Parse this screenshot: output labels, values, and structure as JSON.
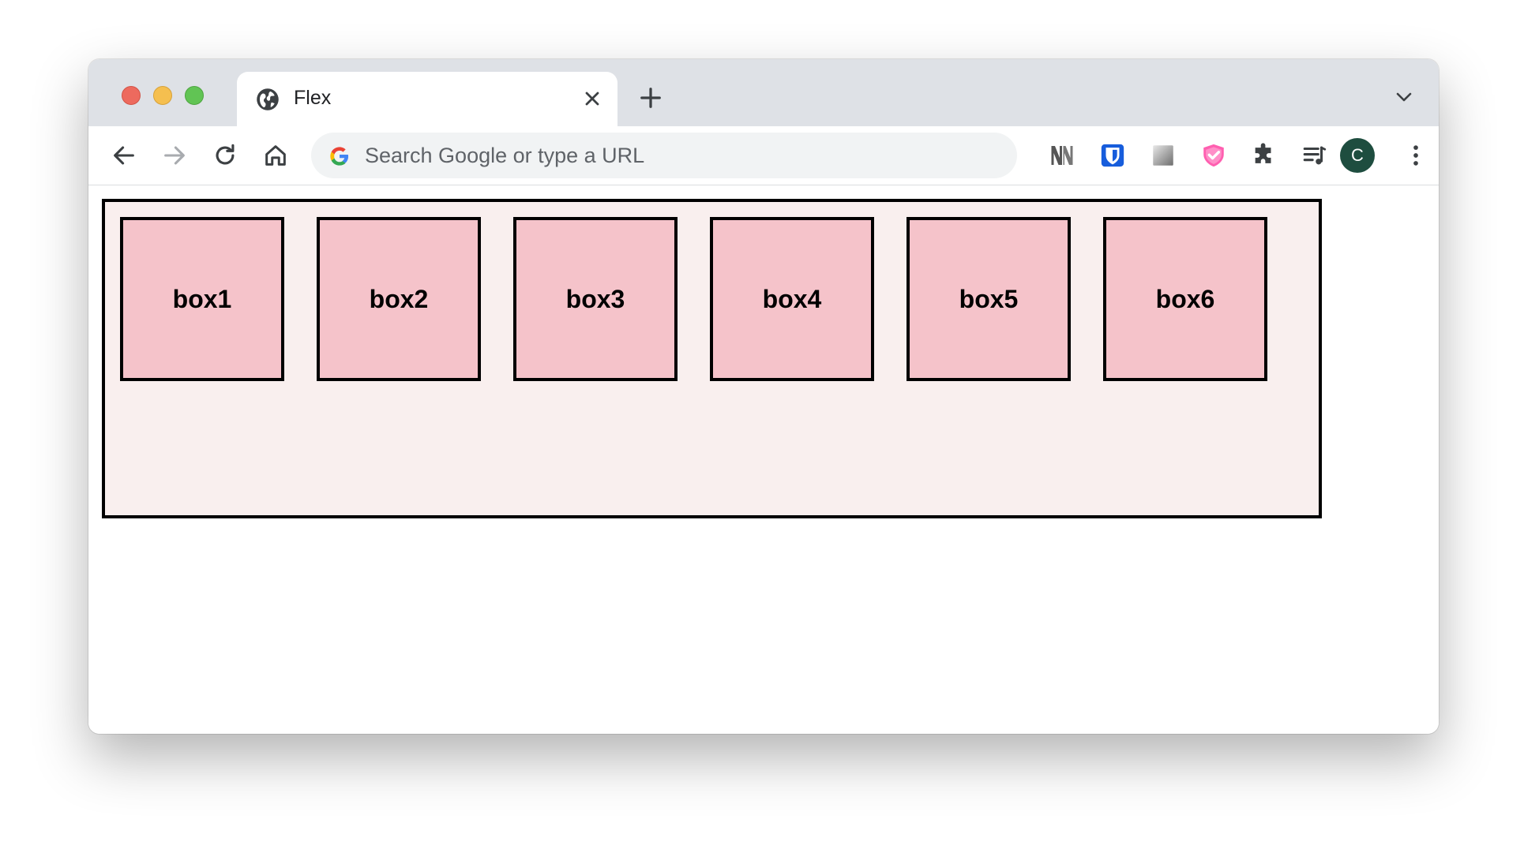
{
  "browser": {
    "tab": {
      "title": "Flex",
      "favicon": "globe-icon"
    },
    "omnibox": {
      "placeholder": "Search Google or type a URL"
    },
    "profile": {
      "initial": "C",
      "color": "#1e4d3f"
    },
    "extensions": [
      "notion-web-clipper-icon",
      "bitwarden-icon",
      "gradient-extension-icon",
      "shield-extension-icon",
      "puzzle-icon",
      "media-control-icon"
    ]
  },
  "page": {
    "container": {
      "background": "#f9efee",
      "border": "#000000"
    },
    "boxes": [
      {
        "label": "box1"
      },
      {
        "label": "box2"
      },
      {
        "label": "box3"
      },
      {
        "label": "box4"
      },
      {
        "label": "box5"
      },
      {
        "label": "box6"
      }
    ],
    "box_color": "#f5c3ca"
  }
}
